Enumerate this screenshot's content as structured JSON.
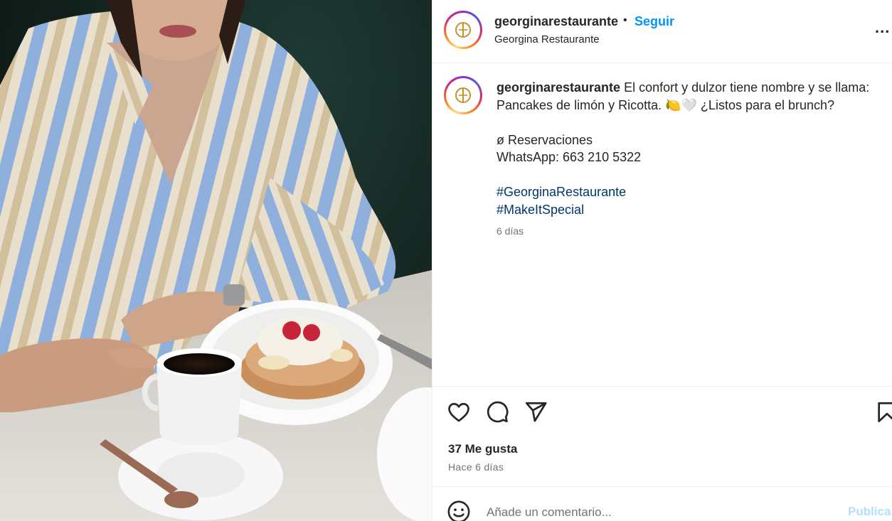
{
  "post": {
    "username": "georginarestaurante",
    "separator": "•",
    "follow_label": "Seguir",
    "subtitle": "Georgina Restaurante",
    "more_label": "..."
  },
  "caption": {
    "username": "georginarestaurante",
    "line1": "El confort y dulzor tiene nombre y se llama:",
    "line2": "Pancakes de limón y Ricotta. 🍋🤍 ¿Listos para el brunch?",
    "line3": "ø Reservaciones",
    "line4": "WhatsApp: 663 210 5322",
    "hashtag1": "#GeorginaRestaurante",
    "hashtag2": "#MakeItSpecial",
    "time": "6 días"
  },
  "actions": {
    "likes": "37 Me gusta",
    "posted_ago": "Hace 6 días"
  },
  "comment": {
    "placeholder": "Añade un comentario...",
    "publish_label": "Publica"
  },
  "icons": [
    "heart-icon",
    "comment-icon",
    "share-icon",
    "bookmark-icon",
    "emoji-icon",
    "more-icon"
  ],
  "colors": {
    "follow_blue": "#0095f6",
    "hashtag_blue": "#00376b",
    "publish_disabled": "#b2dffc",
    "muted_gray": "#737373"
  }
}
